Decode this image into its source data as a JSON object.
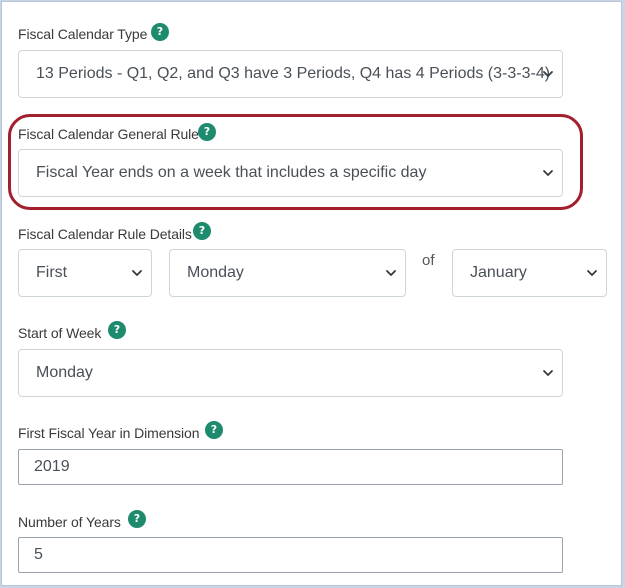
{
  "fiscal_calendar_type": {
    "label": "Fiscal Calendar Type",
    "value": "13 Periods - Q1, Q2, and Q3 have 3 Periods, Q4 has 4 Periods (3-3-3-4)"
  },
  "general_rule": {
    "label": "Fiscal Calendar General Rule",
    "value": "Fiscal Year ends on a week that includes a specific day"
  },
  "rule_details": {
    "label": "Fiscal Calendar Rule Details",
    "ordinal": "First",
    "weekday": "Monday",
    "of_text": "of",
    "month": "January"
  },
  "start_of_week": {
    "label": "Start of Week",
    "value": "Monday"
  },
  "first_fiscal_year": {
    "label": "First Fiscal Year in Dimension",
    "value": "2019"
  },
  "number_of_years": {
    "label": "Number of Years",
    "value": "5"
  },
  "help_glyph": "?",
  "colors": {
    "help_badge": "#1e8a6e",
    "highlight": "#a21f2d"
  }
}
